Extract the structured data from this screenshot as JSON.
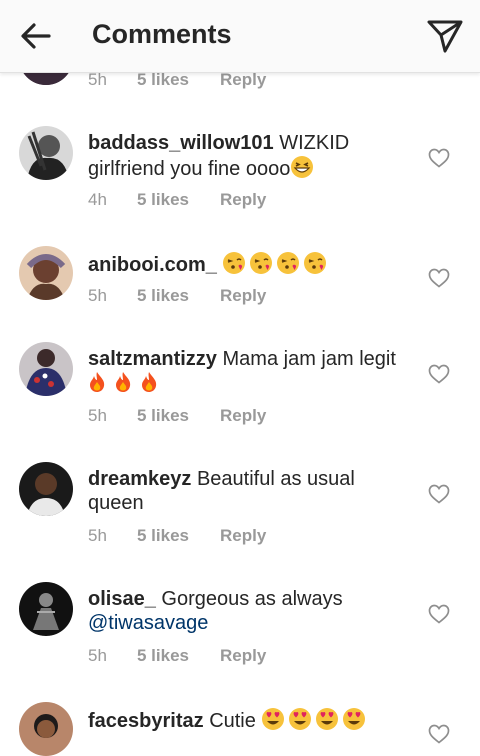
{
  "header": {
    "title": "Comments"
  },
  "top_meta": {
    "time": "5h",
    "likes": "5 likes",
    "reply": "Reply"
  },
  "comments": [
    {
      "username": "baddass_willow101",
      "text_line1": "WIZKID",
      "text_line2": "girlfriend you fine oooo",
      "emoji": "grinning-squinting-face",
      "time": "4h",
      "likes": "5 likes",
      "reply": "Reply"
    },
    {
      "username": "anibooi.com_",
      "emoji": "face-blowing-a-kiss x4",
      "time": "5h",
      "likes": "5 likes",
      "reply": "Reply"
    },
    {
      "username": "saltzmantizzy",
      "text_line1": "Mama jam jam legit",
      "emoji": "fire x3",
      "time": "5h",
      "likes": "5 likes",
      "reply": "Reply"
    },
    {
      "username": "dreamkeyz",
      "text_line1": "Beautiful as usual",
      "text_line2": "queen",
      "time": "5h",
      "likes": "5 likes",
      "reply": "Reply"
    },
    {
      "username": "olisae_",
      "text_line1": "Gorgeous as always",
      "mention": "@tiwasavage",
      "time": "5h",
      "likes": "5 likes",
      "reply": "Reply"
    },
    {
      "username": "facesbyritaz",
      "text_line1": "Cutie",
      "emoji": "heart-eyes x4"
    }
  ],
  "colors": {
    "username": "#262626",
    "meta": "#999999",
    "mention": "#003569",
    "header_bg": "#fafafa"
  }
}
